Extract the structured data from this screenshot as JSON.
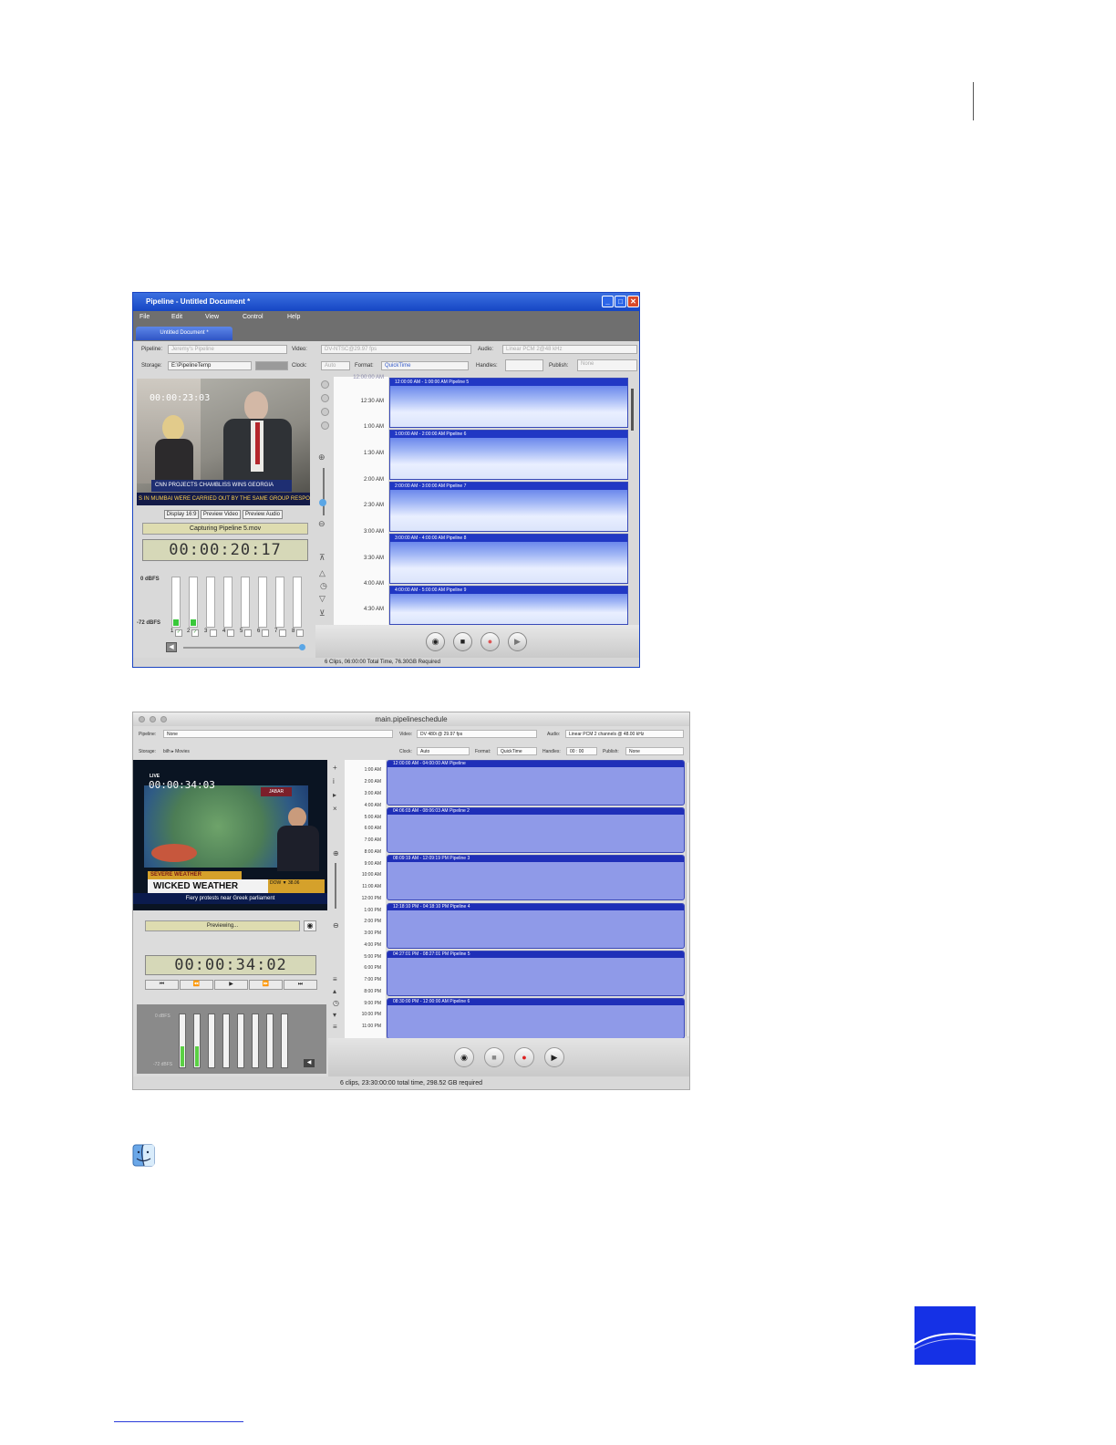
{
  "windows_shot": {
    "title": "Pipeline - Untitled Document *",
    "title_buttons": [
      "_",
      "□",
      "✕"
    ],
    "menu": [
      "File",
      "Edit",
      "View",
      "Control",
      "Help"
    ],
    "tab": "Untitled Document *",
    "pipeline_label": "Pipeline:",
    "pipeline_value": "Jeremy's Pipeline",
    "video_label": "Video:",
    "video_value": "DV-NTSC@29.97 fps",
    "audio_label": "Audio:",
    "audio_value": "Linear PCM 2@48 kHz",
    "storage_label": "Storage:",
    "storage_value": "E:\\PipelineTemp",
    "clock_label": "Clock:",
    "clock_value": "Auto",
    "format_label": "Format:",
    "format_value": "QuickTime",
    "handles_label": "Handles:",
    "publish_label": "Publish:",
    "publish_value": "None",
    "video_timecode": "00:00:23:03",
    "ticker_headline": "CNN PROJECTS CHAMBLISS WINS GEORGIA",
    "ticker_crawl": "S IN MUMBAI WERE CARRIED OUT BY THE SAME GROUP RESPON",
    "buttons": [
      "Display 16:9",
      "Preview Video",
      "Preview Audio"
    ],
    "capture_status": "Capturing Pipeline 5.mov",
    "timecode": "00:00:20:17",
    "meter_top": "0 dBFS",
    "meter_bottom": "-72 dBFS",
    "channels": [
      "1",
      "2",
      "3",
      "4",
      "5",
      "6",
      "7",
      "8"
    ],
    "axis_top": "12:00:00 AM",
    "times": [
      "12:30 AM",
      "1:00 AM",
      "1:30 AM",
      "2:00 AM",
      "2:30 AM",
      "3:00 AM",
      "3:30 AM",
      "4:00 AM",
      "4:30 AM"
    ],
    "clips": [
      {
        "label": "12:00:00 AM - 1:00:00 AM   Pipeline 5"
      },
      {
        "label": "1:00:00 AM - 2:00:00 AM   Pipeline 6"
      },
      {
        "label": "2:00:00 AM - 3:00:00 AM   Pipeline 7"
      },
      {
        "label": "3:00:00 AM - 4:00:00 AM   Pipeline 8"
      },
      {
        "label": "4:00:00 AM - 5:00:00 AM   Pipeline 9"
      }
    ],
    "status": "6 Clips, 06:00:00 Total Time, 76.30GB Required"
  },
  "mac_shot": {
    "title": "main.pipelineschedule",
    "pipeline_label": "Pipeline:",
    "pipeline_value": "None",
    "video_label": "Video:",
    "video_value": "DV 480i @ 29.97 fps",
    "audio_label": "Audio:",
    "audio_value": "Linear PCM 2 channels @ 48.00 kHz",
    "storage_label": "Storage:",
    "storage_value": "bilh ▸ Movies",
    "clock_label": "Clock:",
    "clock_value": "Auto",
    "format_label": "Format:",
    "format_value": "QuickTime",
    "handles_label": "Handles:",
    "handles_value": "00 : 00",
    "publish_label": "Publish:",
    "publish_value": "None",
    "live_tag": "LIVE",
    "video_timecode": "00:00:34:03",
    "severe": "SEVERE WEATHER",
    "headline": "WICKED WEATHER",
    "crawl": "Fiery protests near Greek parliament",
    "dow": "DOW ▼ 38.06",
    "preview_status": "Previewing...",
    "timecode": "00:00:34:02",
    "transport_buttons": [
      "⏮",
      "⏪",
      "▶",
      "⏩",
      "⏭"
    ],
    "meter_top": "0 dBFS",
    "meter_bottom": "-72 dBFS",
    "times": [
      "1:00 AM",
      "2:00 AM",
      "3:00 AM",
      "4:00 AM",
      "5:00 AM",
      "6:00 AM",
      "7:00 AM",
      "8:00 AM",
      "9:00 AM",
      "10:00 AM",
      "11:00 AM",
      "12:00 PM",
      "1:00 PM",
      "2:00 PM",
      "3:00 PM",
      "4:00 PM",
      "5:00 PM",
      "6:00 PM",
      "7:00 PM",
      "8:00 PM",
      "9:00 PM",
      "10:00 PM",
      "11:00 PM"
    ],
    "clips": [
      {
        "label": "12:00:00 AM - 04:00:00 AM   Pipeline"
      },
      {
        "label": "04:06:03 AM - 08:06:03 AM   Pipeline 2"
      },
      {
        "label": "08:09:19 AM - 12:09:19 PM   Pipeline 3"
      },
      {
        "label": "12:18:10 PM - 04:18:10 PM   Pipeline 4"
      },
      {
        "label": "04:27:01 PM - 08:27:01 PM   Pipeline 5"
      },
      {
        "label": "08:30:00 PM - 12:00:00 AM   Pipeline 6"
      }
    ],
    "status": "6 clips, 23:30:00:00 total time, 298.52 GB required"
  },
  "colors": {
    "accent": "#1531e6",
    "win_title": "#1546c4",
    "clip_head": "#2138c4",
    "meter_green": "#39c83a"
  },
  "icons": [
    "finder-icon",
    "corner-logo"
  ]
}
